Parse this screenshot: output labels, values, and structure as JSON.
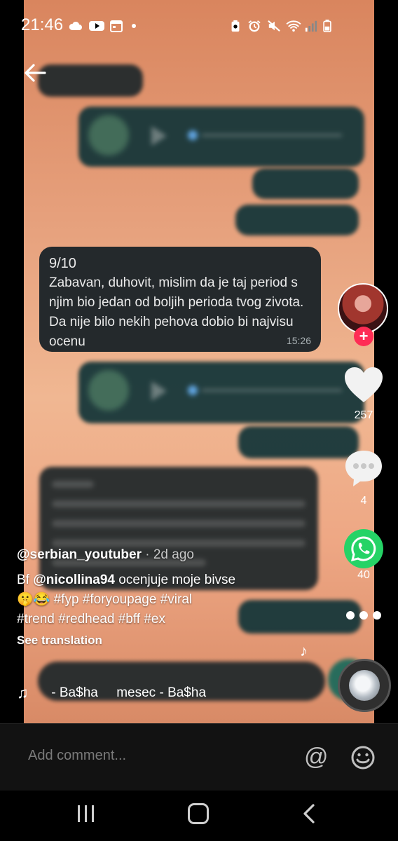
{
  "status_bar": {
    "time": "21:46"
  },
  "video": {
    "visible_message": {
      "rating": "9/10",
      "text": "Zabavan, duhovit, mislim da je taj period s njim bio jedan od boljih perioda tvog zivota. Da nije bilo nekih pehova dobio bi najvisu ocenu",
      "time": "15:26"
    }
  },
  "rail": {
    "like_count": "257",
    "comment_count": "4",
    "share_count": "40"
  },
  "caption": {
    "username": "@serbian_youtuber",
    "separator": " · ",
    "posted": "2d ago",
    "description_start": "Bf ",
    "mention": "@nicollina94",
    "description_rest": " ocenjuje moje bivse",
    "emojis": "🤫😂",
    "hashtags_line1": " #fyp #foryoupage #viral",
    "hashtags_line2": "#trend #redhead #bff #ex",
    "see_translation": "See translation",
    "music": " - Ba$ha     mesec - Ba$ha"
  },
  "comment_bar": {
    "placeholder": "Add comment..."
  },
  "colors": {
    "accent_follow": "#fe2c55",
    "whatsapp": "#25d366"
  },
  "icons": [
    "back-arrow-icon",
    "heart-icon",
    "comment-icon",
    "whatsapp-icon",
    "more-icon",
    "music-note-icon",
    "at-icon",
    "emoji-icon"
  ]
}
